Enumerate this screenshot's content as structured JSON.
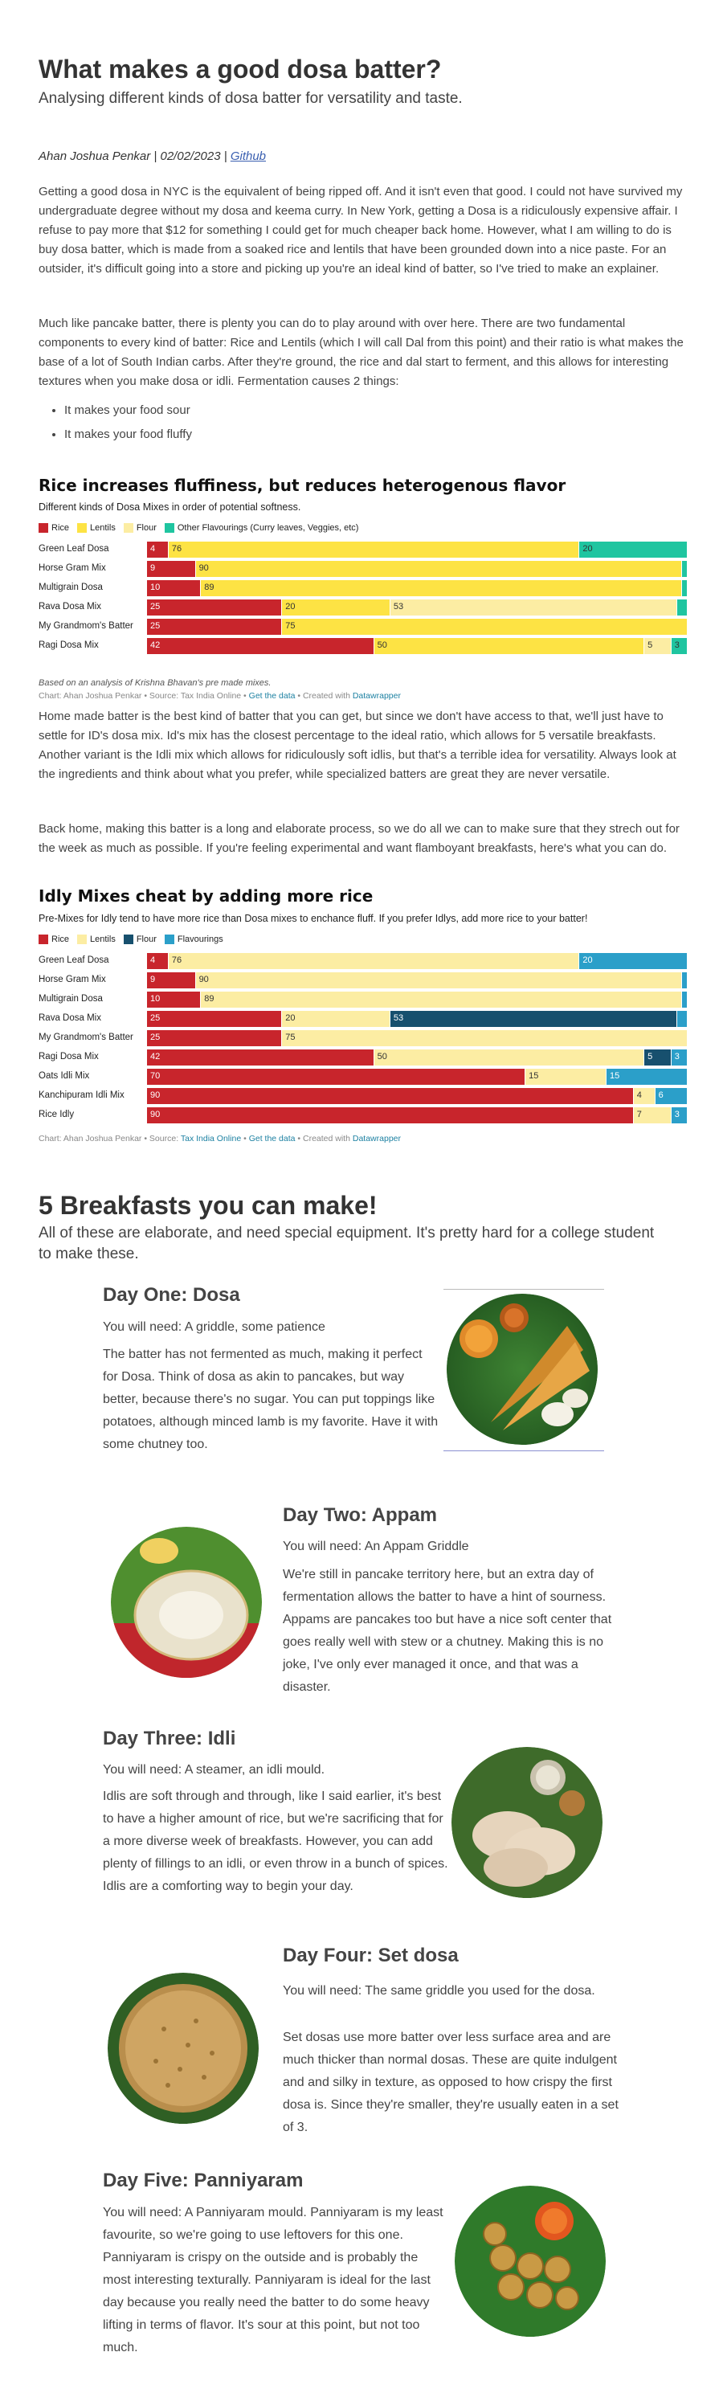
{
  "header": {
    "title": "What makes a good dosa batter?",
    "subtitle": "Analysing different kinds of dosa batter for versatility and taste."
  },
  "byline": {
    "author_date": "Ahan Joshua Penkar | 02/02/2023 |",
    "link": "Github"
  },
  "intro": {
    "p1": "Getting a good dosa in NYC is the equivalent of being ripped off. And it isn't even that good. I could not have survived my undergraduate degree without my dosa and keema curry. In New York, getting a Dosa is a ridiculously expensive affair. I refuse to pay more that $12 for something I could get for much cheaper back home. However, what I am willing to do is buy dosa batter, which is made from a soaked rice and lentils that have been grounded down into a nice paste. For an outsider, it's difficult going into a store and picking up you're an ideal kind of batter, so I've tried to make an explainer.",
    "p2": "Much like pancake batter, there is plenty you can do to play around with over here. There are two fundamental components to every kind of batter: Rice and Lentils (which I will call Dal from this point) and their ratio is what makes the base of a lot of South Indian carbs. After they're ground, the rice and dal start to ferment, and this allows for interesting textures when you make dosa or idli. Fermentation causes 2 things:",
    "bullets": [
      "It makes your food sour",
      "It makes your food fluffy"
    ]
  },
  "colors": {
    "rice": "#c8252c",
    "lentils": "#fde344",
    "flour": "#fceda3",
    "flavour_teal": "#1fc5a0",
    "flavour_blue": "#2b9fc9",
    "flour_dark": "#17506e",
    "link": "#1d81a2"
  },
  "chart1_text": {
    "title": "Rice increases fluffiness, but reduces heterogenous flavor",
    "subtitle": "Different kinds of Dosa Mixes in order of potential softness.",
    "note": "Based on an analysis of Krishna Bhavan's pre made mixes.",
    "credit_prefix": "Chart: Ahan Joshua Penkar • Source: Tax India Online •",
    "credit_data": "Get the data",
    "credit_mid": "• Created with",
    "credit_tool": "Datawrapper"
  },
  "middle": {
    "p1": "Home made batter is the best kind of batter that you can get, but since we don't have access to that, we'll just have to settle for ID's dosa mix. Id's mix has the closest percentage to the ideal ratio, which allows for 5 versatile breakfasts. Another variant is the Idli mix which allows for ridiculously soft idlis, but that's a terrible idea for versatility. Always look at the ingredients and think about what you prefer, while specialized batters are great they are never versatile.",
    "p2": "Back home, making this batter is a long and elaborate process, so we do all we can to make sure that they strech out for the week as much as possible. If you're feeling experimental and want flamboyant breakfasts, here's what you can do."
  },
  "chart2_text": {
    "title": "Idly Mixes cheat by adding more rice",
    "subtitle": "Pre-Mixes for Idly tend to have more rice than Dosa mixes to enchance fluff. If you prefer Idlys, add more rice to your batter!",
    "credit_prefix": "Chart: Ahan Joshua Penkar • Source:",
    "credit_source": "Tax India Online",
    "credit_sep": "•",
    "credit_data": "Get the data",
    "credit_mid": "• Created with",
    "credit_tool": "Datawrapper"
  },
  "chart_data": [
    {
      "type": "bar",
      "orientation": "horizontal-stacked",
      "title": "Rice increases fluffiness, but reduces heterogenous flavor",
      "subtitle": "Different kinds of Dosa Mixes in order of potential softness.",
      "legend_placement": "top-left",
      "categories": [
        "Green Leaf Dosa",
        "Horse Gram Mix",
        "Multigrain Dosa",
        "Rava Dosa Mix",
        "My Grandmom's Batter",
        "Ragi Dosa Mix"
      ],
      "series": [
        {
          "name": "Rice",
          "color": "#c8252c",
          "values": [
            4,
            9,
            10,
            25,
            25,
            42
          ]
        },
        {
          "name": "Lentils",
          "color": "#fde344",
          "values": [
            76,
            90,
            89,
            20,
            75,
            50
          ]
        },
        {
          "name": "Flour",
          "color": "#fceda3",
          "values": [
            0,
            0,
            0,
            53,
            0,
            5
          ]
        },
        {
          "name": "Other Flavourings (Curry leaves, Veggies, etc)",
          "color": "#1fc5a0",
          "values": [
            20,
            1,
            1,
            2,
            0,
            3
          ]
        }
      ],
      "xlim": [
        0,
        100
      ]
    },
    {
      "type": "bar",
      "orientation": "horizontal-stacked",
      "title": "Idly Mixes cheat by adding more rice",
      "subtitle": "Pre-Mixes for Idly tend to have more rice than Dosa mixes to enchance fluff. If you prefer Idlys, add more rice to your batter!",
      "legend_placement": "top-left",
      "categories": [
        "Green Leaf Dosa",
        "Horse Gram Mix",
        "Multigrain Dosa",
        "Rava Dosa Mix",
        "My Grandmom's Batter",
        "Ragi Dosa Mix",
        "Oats Idli Mix",
        "Kanchipuram Idli Mix",
        "Rice Idly"
      ],
      "series": [
        {
          "name": "Rice",
          "color": "#c8252c",
          "values": [
            4,
            9,
            10,
            25,
            25,
            42,
            70,
            90,
            90
          ]
        },
        {
          "name": "Lentils",
          "color": "#fceda3",
          "values": [
            76,
            90,
            89,
            20,
            75,
            50,
            15,
            4,
            7
          ]
        },
        {
          "name": "Flour",
          "color": "#17506e",
          "values": [
            0,
            0,
            0,
            53,
            0,
            5,
            0,
            0,
            0
          ]
        },
        {
          "name": "Flavourings",
          "color": "#2b9fc9",
          "values": [
            20,
            1,
            1,
            2,
            0,
            3,
            15,
            6,
            3
          ]
        }
      ],
      "xlim": [
        0,
        100
      ]
    }
  ],
  "breakfasts": {
    "title": "5 Breakfasts you can make!",
    "subtitle": "All of these are elaborate, and need special equipment. It's pretty hard for a college student to make these.",
    "days": [
      {
        "title": "Day One: Dosa",
        "need": "You will need: A griddle, some patience",
        "body": "The batter has not fermented as much, making it perfect for Dosa. Think of dosa as akin to pancakes, but way better, because there's no sugar. You can put toppings like potatoes, although minced lamb is my favorite. Have it with some chutney too.",
        "image": "dosa-photo"
      },
      {
        "title": "Day Two: Appam",
        "need": "You will need: An Appam Griddle",
        "body": "We're still in pancake territory here, but an extra day of fermentation allows the batter to have a hint of sourness. Appams are pancakes too but have a nice soft center that goes really well with stew or a chutney. Making this is no joke, I've only ever managed it once, and that was a disaster.",
        "image": "appam-photo"
      },
      {
        "title": "Day Three: Idli",
        "need": "You will need: A steamer, an idli mould.",
        "body": "Idlis are soft through and through, like I said earlier, it's best to have a higher amount of rice, but we're sacrificing that for a more diverse week of breakfasts. However, you can add plenty of fillings to an idli, or even throw in a bunch of spices. Idlis are a comforting way to begin your day.",
        "image": "idli-photo"
      },
      {
        "title": "Day Four: Set dosa",
        "need": "You will need: The same griddle you used for the dosa.",
        "body": "Set dosas use more batter over less surface area and are much thicker than normal dosas. These are quite indulgent and and silky in texture, as opposed to how crispy the first dosa is. Since they're smaller, they're usually eaten in a set of 3.",
        "image": "set-dosa-photo"
      },
      {
        "title": "Day Five: Panniyaram",
        "need": "",
        "body": "You will need: A Panniyaram mould. Panniyaram is my least favourite, so we're going to use leftovers for this one. Panniyaram is crispy on the outside and is probably the most interesting texturally. Panniyaram is ideal for the last day because you really need the batter to do some heavy lifting in terms of flavor. It's sour at this point, but not too much.",
        "image": "panniyaram-photo"
      }
    ]
  }
}
